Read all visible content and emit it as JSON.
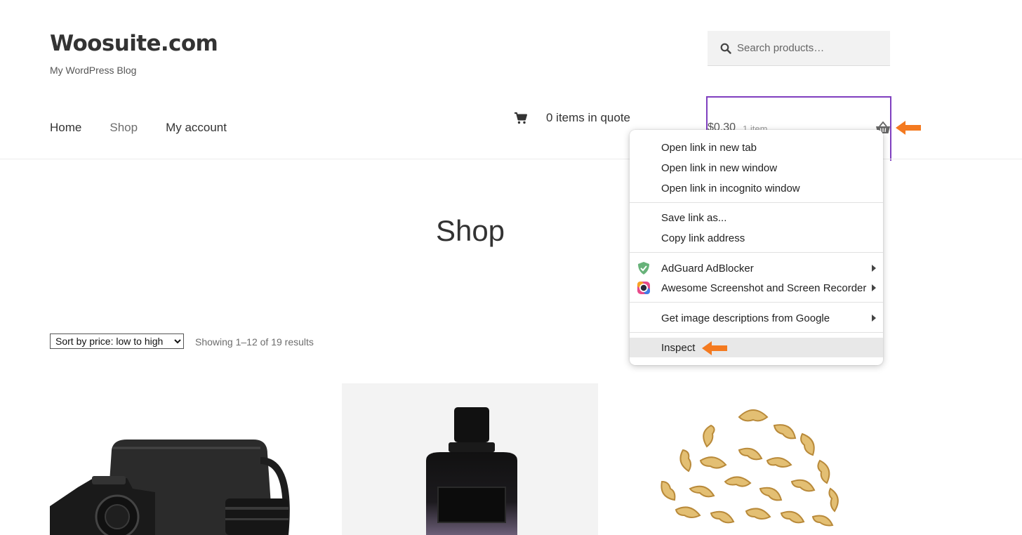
{
  "site": {
    "title": "Woosuite.com",
    "tagline": "My WordPress Blog"
  },
  "search": {
    "placeholder": "Search products…"
  },
  "nav": {
    "items": [
      {
        "label": "Home"
      },
      {
        "label": "Shop"
      },
      {
        "label": "My account"
      }
    ]
  },
  "quote": {
    "label": "0 items in quote"
  },
  "cart": {
    "amount": "$0.30",
    "count": "1 item"
  },
  "page": {
    "title": "Shop"
  },
  "toolbar": {
    "sort_selected": "Sort by price: low to high",
    "results": "Showing 1–12 of 19 results"
  },
  "context_menu": {
    "open_new_tab": "Open link in new tab",
    "open_new_window": "Open link in new window",
    "open_incognito": "Open link in incognito window",
    "save_link": "Save link as...",
    "copy_link": "Copy link address",
    "adguard": "AdGuard AdBlocker",
    "awesome_screenshot": "Awesome Screenshot and Screen Recorder",
    "image_descriptions": "Get image descriptions from Google",
    "inspect": "Inspect"
  },
  "colors": {
    "accent_border": "#7f3fbf",
    "annotation_arrow": "#f47a20"
  },
  "icons": [
    "search-icon",
    "cart-icon",
    "basket-icon",
    "shield-icon",
    "camera-lens-icon",
    "arrow-icon"
  ]
}
